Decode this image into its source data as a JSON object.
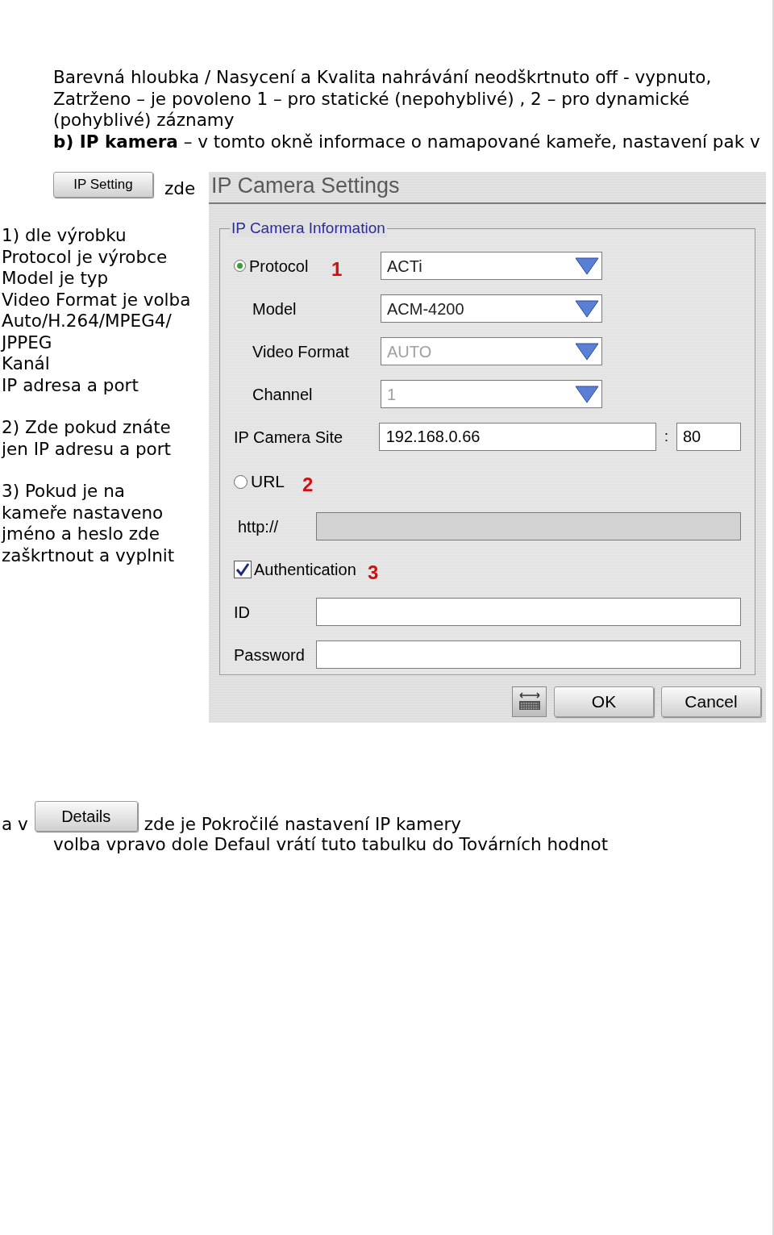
{
  "intro": {
    "text": "Barevná hloubka / Nasycení a Kvalita nahrávání neodškrtnuto off - vypnuto, Zatrženo – je povoleno 1 – pro statické (nepohyblivé) , 2 – pro dynamické (pohyblivé) záznamy",
    "note": "**b) IP kamera** – v tomto okně informace o namapované kameře, nastavení pak v"
  },
  "ip_setting": {
    "button": "IP Setting",
    "suffix": "zde"
  },
  "notes": [
    {
      "lines": [
        "1) dle výrobku",
        "Protocol je výrobce",
        "Model je typ",
        "Video Format je volba",
        "Auto/H.264/MPEG4/",
        "JPPEG",
        "Kanál",
        "IP adresa a port"
      ]
    },
    {
      "lines": [
        "2) Zde pokud znáte",
        "jen IP adresu a port"
      ]
    },
    {
      "lines": [
        "3) Pokud je na",
        "kameře nastaveno",
        "jméno a heslo zde",
        "zaškrtnout a vyplnit"
      ]
    }
  ],
  "dialog": {
    "title": "IP Camera Settings",
    "group_title": "IP Camera Information",
    "protocol": {
      "selected": true,
      "marker": "1"
    },
    "dropdowns": [
      {
        "label": "Protocol",
        "value": "ACTi",
        "disabled": false
      },
      {
        "label": "Model",
        "value": "ACM-4200",
        "disabled": false
      },
      {
        "label": "Video Format",
        "value": "AUTO",
        "disabled": true
      },
      {
        "label": "Channel",
        "value": "1",
        "disabled": true
      }
    ],
    "site": {
      "label": "IP Camera Site",
      "value": "192.168.0.66",
      "separator": ":",
      "port": "80"
    },
    "url": {
      "label": "URL",
      "selected": false,
      "marker": "2",
      "prefix": "http://",
      "disabled": true
    },
    "auth": {
      "label": "Authentication",
      "checked": true,
      "marker": "3"
    },
    "credentials": [
      {
        "label": "ID"
      },
      {
        "label": "Password"
      }
    ],
    "buttons": [
      "OK",
      "Cancel"
    ]
  },
  "footer": {
    "prefix": "a v",
    "button": "Details",
    "text": "zde je Pokročilé nastavení IP kamery",
    "line2": "volba vpravo dole Defaul vrátí tuto tabulku do Továrních hodnot"
  }
}
